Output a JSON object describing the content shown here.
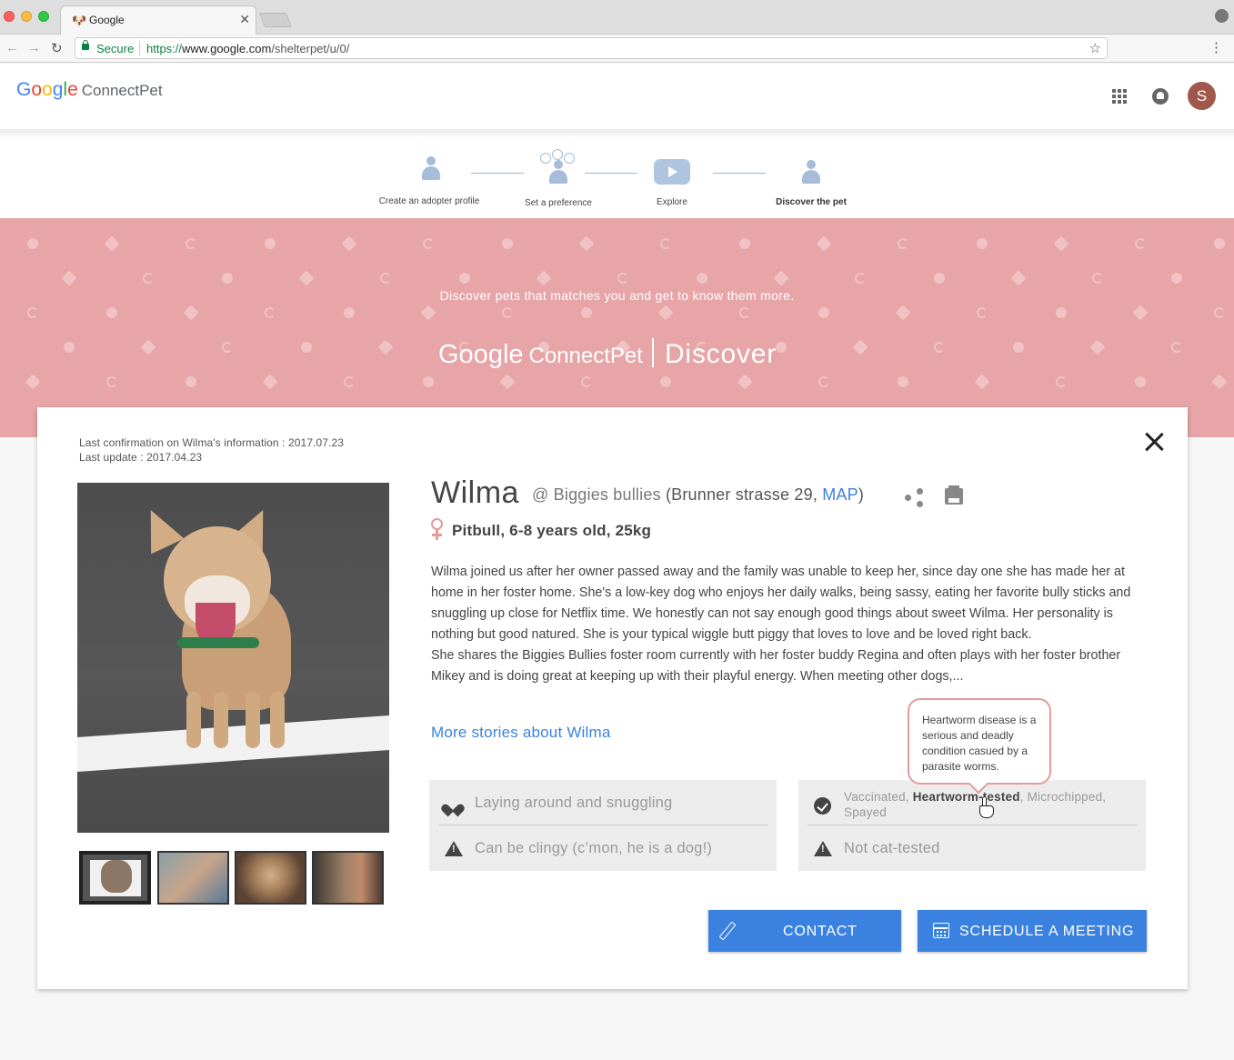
{
  "browser": {
    "tab_title": "Google",
    "tab_favicon": "dog-favicon",
    "secure_label": "Secure",
    "url_scheme": "https://",
    "url_host": "www.google.com",
    "url_path": "/shelterpet/u/0/"
  },
  "app": {
    "logo_google": [
      "G",
      "o",
      "o",
      "g",
      "l",
      "e"
    ],
    "logo_product": "ConnectPet",
    "avatar_initial": "S"
  },
  "steps": [
    {
      "label": "Create an adopter profile",
      "icon": "person-icon"
    },
    {
      "label": "Set a preference",
      "icon": "person-balloons-icon"
    },
    {
      "label": "Explore",
      "icon": "play-icon"
    },
    {
      "label": "Discover the pet",
      "icon": "person-icon",
      "active": true
    }
  ],
  "banner": {
    "tagline": "Discover pets that matches you and get to know them more.",
    "logo_google": "Google",
    "logo_product": "ConnectPet",
    "section": "Discover",
    "color": "#e7a5a7"
  },
  "pet": {
    "last_confirmation": "Last confirmation on Wilma's information : 2017.07.23",
    "last_update": "Last update : 2017.04.23",
    "name": "Wilma",
    "shelter_prefix": "@ Biggies bullies",
    "address_open": "(Brunner strasse 29, ",
    "map_link": "MAP",
    "address_close": ")",
    "details": "Pitbull, 6-8 years old, 25kg",
    "story_1": "Wilma joined us after her owner passed away and the family was unable to keep her, since day one she has made her at home in her foster home. She's a low-key dog who enjoys her daily walks, being sassy, eating her favorite bully sticks and snuggling up close for Netflix time. We honestly can not say enough good things about sweet Wilma. Her personality is nothing but good natured. She is your typical wiggle butt piggy that loves to love and be loved right back.",
    "story_2": "She shares the Biggies Bullies foster room currently with her foster buddy Regina and often plays with her foster brother Mikey and is doing great at keeping up with their playful energy. When meeting other dogs,...",
    "more_link": "More stories about Wilma",
    "traits": [
      {
        "icon": "heart-icon",
        "text": "Laying around and snuggling"
      },
      {
        "icon": "warning-icon",
        "text": "Can be clingy (c’mon, he is a dog!)"
      }
    ],
    "health_pre": "Vaccinated, ",
    "health_bold": "Heartworm-tested",
    "health_post": ", Microchipped, Spayed",
    "health_warning": "Not cat-tested",
    "tooltip": "Heartworm disease is a serious and deadly condition casued by a parasite worms.",
    "contact_label": "CONTACT",
    "schedule_label": "SCHEDULE A MEETING",
    "accent_color": "#3b82e0"
  }
}
